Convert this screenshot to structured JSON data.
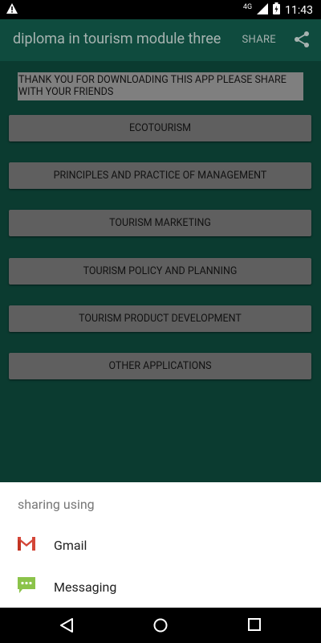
{
  "status_bar": {
    "network": "4G",
    "time": "11:43",
    "warning_icon": "warning-icon",
    "battery_icon": "battery-icon",
    "signal_icon": "signal-icon"
  },
  "app_bar": {
    "title": "diploma in tourism module three",
    "share_label": "SHARE",
    "share_icon": "share-icon"
  },
  "content": {
    "thanks_text_line1": "THANK YOU FOR DOWNLOADING THIS APP PLEASE SHARE",
    "thanks_text_line2": "WITH YOUR FRIENDS",
    "buttons": [
      "ECOTOURISM",
      "PRINCIPLES AND PRACTICE OF MANAGEMENT",
      "TOURISM MARKETING",
      "TOURISM POLICY AND PLANNING",
      "TOURISM PRODUCT DEVELOPMENT",
      "OTHER APPLICATIONS"
    ]
  },
  "share_sheet": {
    "heading": "sharing using",
    "options": [
      {
        "label": "Gmail",
        "icon": "gmail-icon"
      },
      {
        "label": "Messaging",
        "icon": "messaging-icon"
      }
    ]
  },
  "nav_bar": {
    "back_icon": "back-icon",
    "home_icon": "home-icon",
    "recents_icon": "recents-icon"
  }
}
